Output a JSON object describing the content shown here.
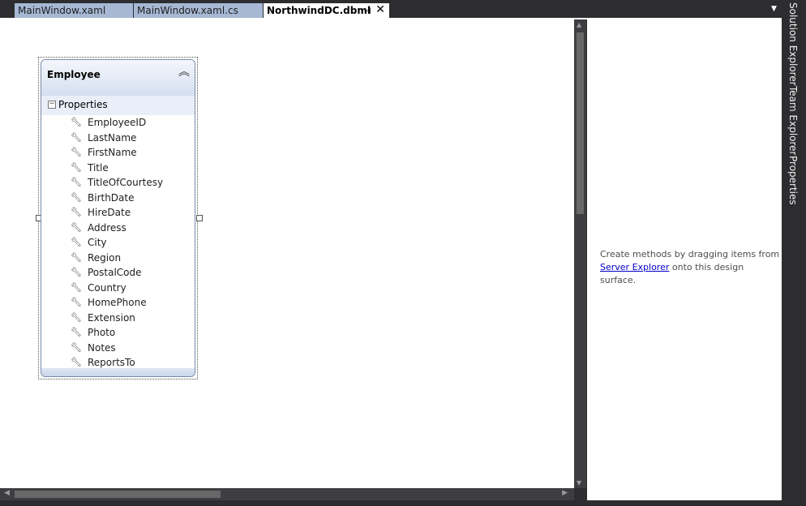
{
  "tabs": [
    {
      "label": "MainWindow.xaml",
      "active": false
    },
    {
      "label": "MainWindow.xaml.cs",
      "active": false
    },
    {
      "label": "NorthwindDC.dbml",
      "active": true
    }
  ],
  "tab_icons": {
    "pin": "pin-icon",
    "close": "close-icon",
    "dropdown": "dropdown-arrow-icon"
  },
  "entity": {
    "title": "Employee",
    "section_label": "Properties",
    "properties": [
      "EmployeeID",
      "LastName",
      "FirstName",
      "Title",
      "TitleOfCourtesy",
      "BirthDate",
      "HireDate",
      "Address",
      "City",
      "Region",
      "PostalCode",
      "Country",
      "HomePhone",
      "Extension",
      "Photo",
      "Notes",
      "ReportsTo"
    ]
  },
  "methods_pane": {
    "message_prefix": "Create methods by dragging items from",
    "link_text": "Server Explorer",
    "message_suffix": "onto this design surface."
  },
  "side_tabs": [
    "Solution Explorer",
    "Team Explorer",
    "Properties"
  ],
  "colors": {
    "chrome": "#2d2d30",
    "tab_inactive": "#a6b8d4",
    "tab_active": "#ffffff",
    "link": "#0000cc"
  }
}
